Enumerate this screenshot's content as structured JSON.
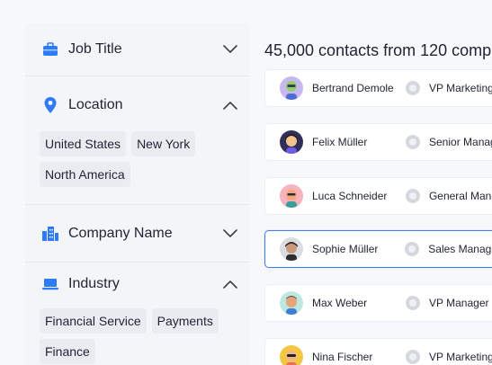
{
  "filters": [
    {
      "title": "Job Title",
      "icon": "briefcase-icon",
      "expanded": false,
      "chips": []
    },
    {
      "title": "Location",
      "icon": "location-pin-icon",
      "expanded": true,
      "chips": [
        "United States",
        "New York",
        "North America"
      ]
    },
    {
      "title": "Company Name",
      "icon": "building-icon",
      "expanded": false,
      "chips": []
    },
    {
      "title": "Industry",
      "icon": "laptop-icon",
      "expanded": true,
      "chips": [
        "Financial Service",
        "Payments",
        "Finance"
      ]
    }
  ],
  "results": {
    "heading": "45,000 contacts from 120 comp"
  },
  "contacts": [
    {
      "name": "Bertrand Demole",
      "title": "VP Marketing",
      "avatar_bg": "#c9b8f0",
      "selected": false
    },
    {
      "name": "Felix Müller",
      "title": "Senior Manag",
      "avatar_bg": "#2f2f5a",
      "selected": false
    },
    {
      "name": "Luca Schneider",
      "title": "General Mana",
      "avatar_bg": "#f6b3bd",
      "selected": false
    },
    {
      "name": "Sophie Müller",
      "title": "Sales Manage",
      "avatar_bg": "#d9dde4",
      "selected": true
    },
    {
      "name": "Max Weber",
      "title": "VP Manager",
      "avatar_bg": "#bfe7e2",
      "selected": false
    },
    {
      "name": "Nina Fischer",
      "title": "VP Marketing",
      "avatar_bg": "#f2c744",
      "selected": false
    }
  ],
  "colors": {
    "accent": "#3d7ef5",
    "icon_blue": "#2f7bf5"
  }
}
